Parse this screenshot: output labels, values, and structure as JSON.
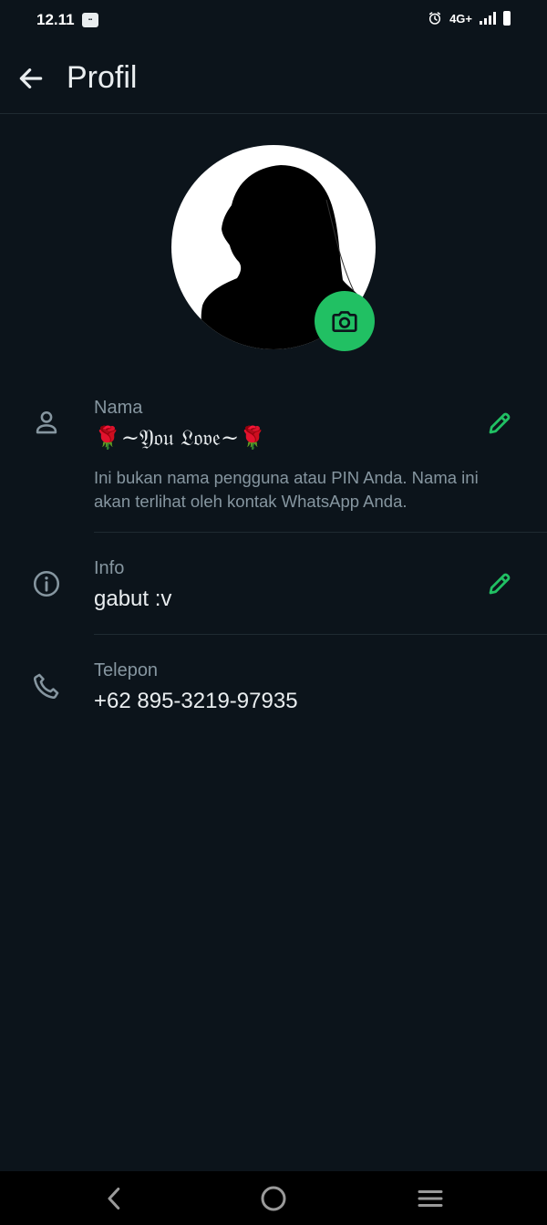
{
  "status_bar": {
    "time": "12.11",
    "network": "4G+",
    "icons": [
      "notification-icon",
      "alarm-icon",
      "signal-icon",
      "battery-icon"
    ]
  },
  "app_bar": {
    "title": "Profil",
    "back_icon": "arrow-left-icon"
  },
  "avatar": {
    "camera_icon": "camera-icon",
    "accent": "#21c063"
  },
  "name_section": {
    "label": "Nama",
    "value": "🌹~𝔜𝔬𝔲 𝔏𝔬𝔳𝔢~🌹",
    "help": "Ini bukan nama pengguna atau PIN Anda. Nama ini akan terlihat oleh kontak WhatsApp Anda.",
    "icon": "person-icon",
    "edit_icon": "pencil-icon"
  },
  "info_section": {
    "label": "Info",
    "value": "gabut :v",
    "icon": "info-icon",
    "edit_icon": "pencil-icon"
  },
  "phone_section": {
    "label": "Telepon",
    "value": "+62 895-3219-97935",
    "icon": "phone-icon"
  },
  "nav_bar": {
    "icons": [
      "nav-back-icon",
      "nav-home-icon",
      "nav-menu-icon"
    ]
  },
  "colors": {
    "background": "#0c141b",
    "text_primary": "#e9edef",
    "text_secondary": "#8696a0",
    "accent_green": "#21c063"
  }
}
